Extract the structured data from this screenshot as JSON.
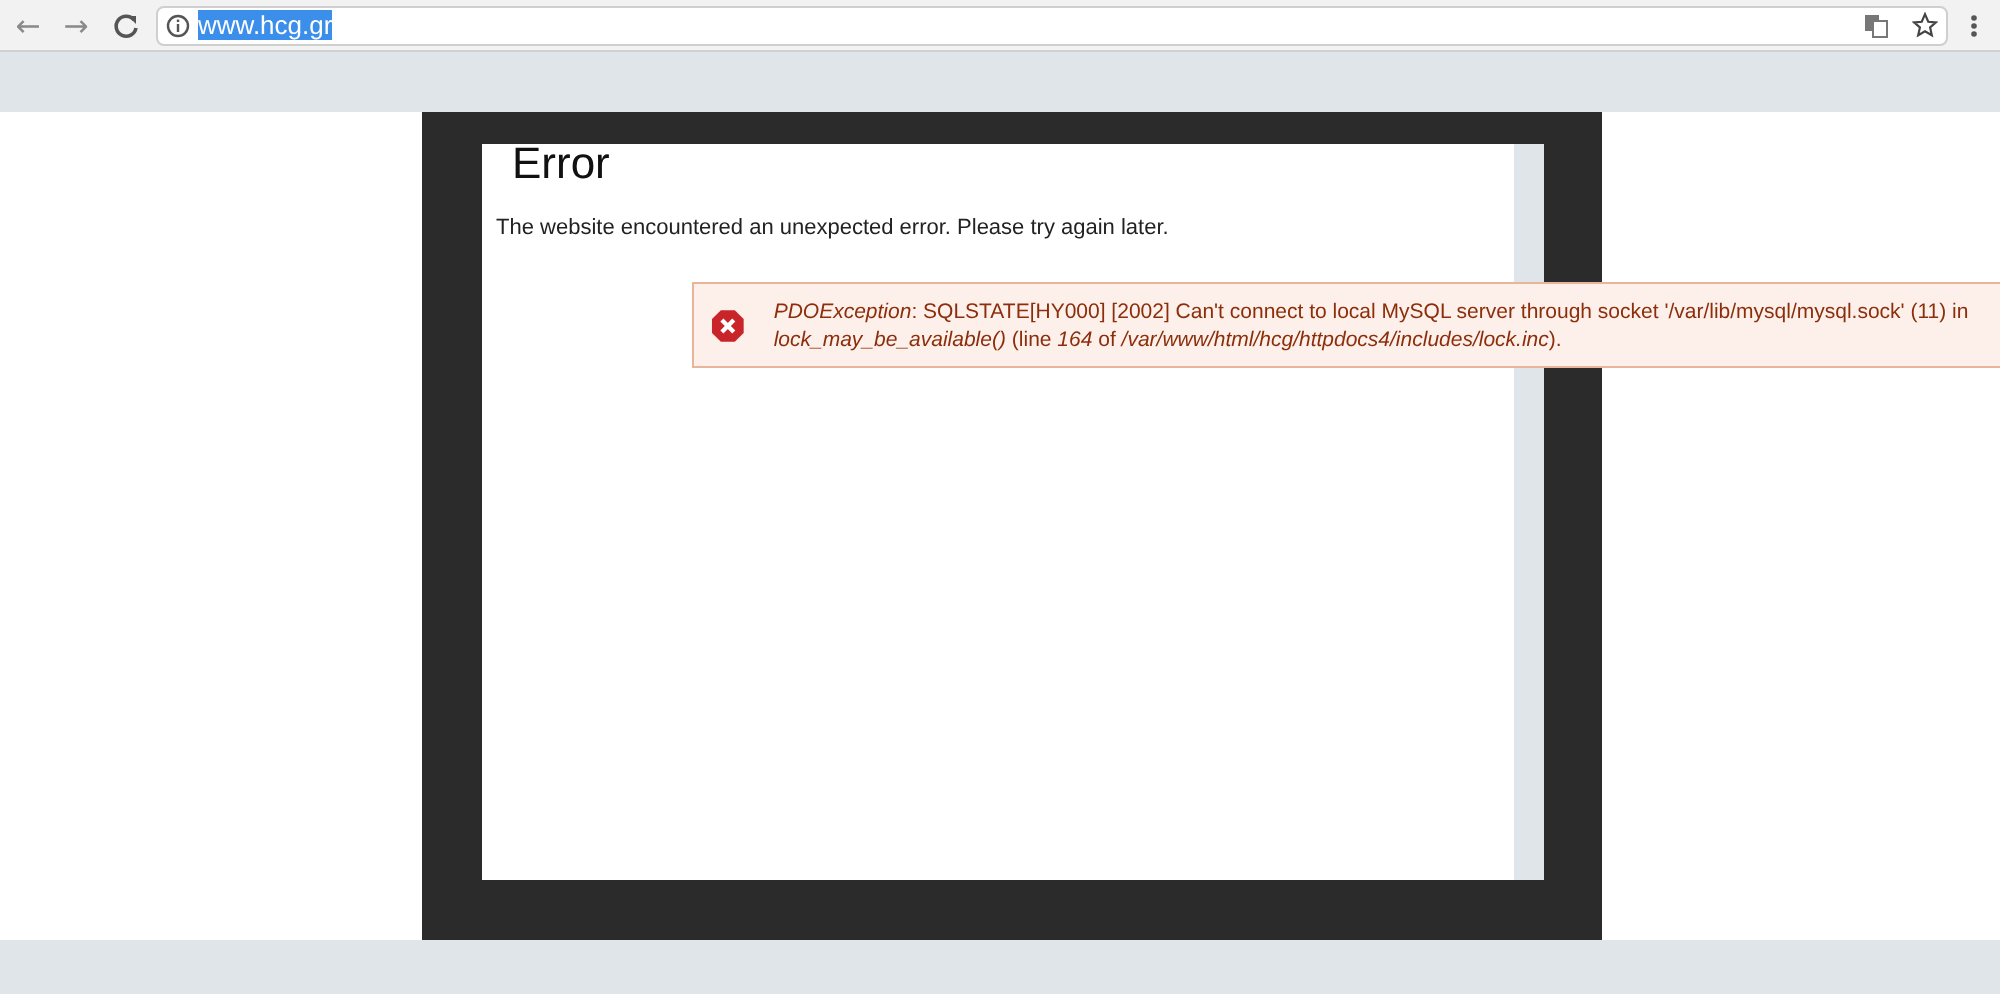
{
  "browser": {
    "back": "←",
    "forward": "→",
    "url": "www.hcg.gr",
    "url_selected": true
  },
  "page": {
    "title": "Error",
    "message": "The website encountered an unexpected error. Please try again later."
  },
  "error_message": {
    "text": "*PDOException*: SQLSTATE[HY000] [2002] Can't connect to local MySQL server through socket '/var/lib/mysql/mysql.sock' (11) in *lock_may_be_available()* (line *164* of */var/www/html/hcg/httpdocs4/includes/lock.inc*)."
  }
}
